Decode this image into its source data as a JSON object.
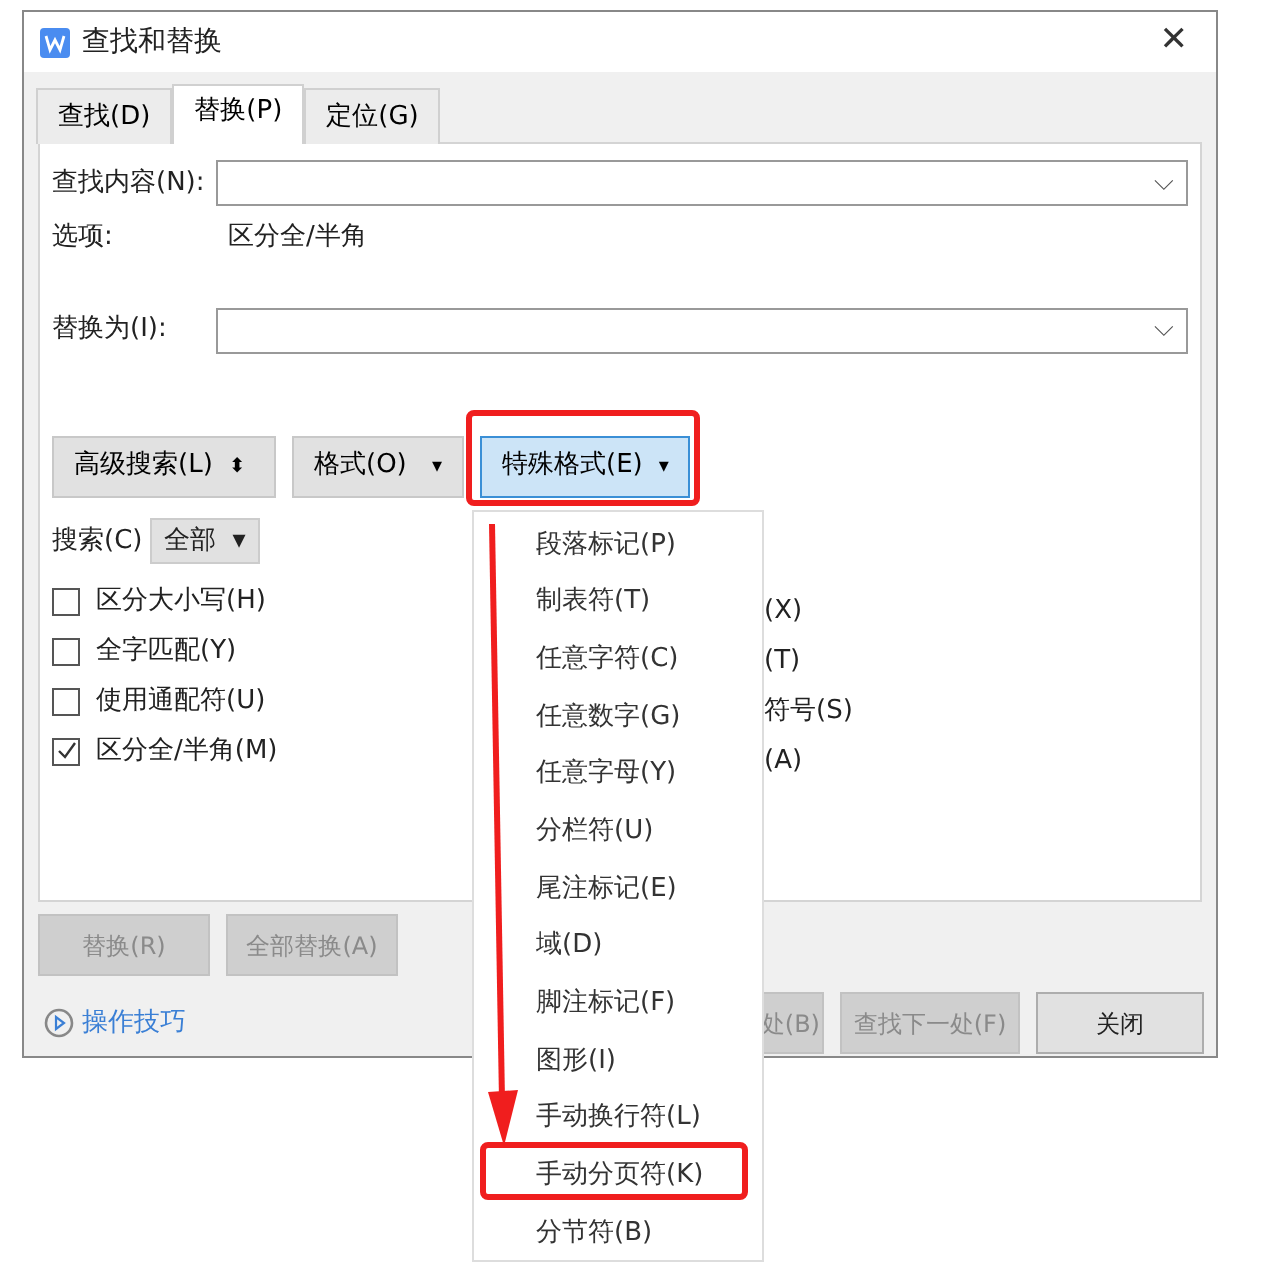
{
  "window": {
    "title": "查找和替换",
    "close": "✕"
  },
  "tabs": [
    {
      "label": "查找(D)",
      "selected": false
    },
    {
      "label": "替换(P)",
      "selected": true
    },
    {
      "label": "定位(G)",
      "selected": false
    }
  ],
  "find": {
    "label": "查找内容(N):",
    "caret": "⌵"
  },
  "options": {
    "label": "选项:",
    "value": "区分全/半角"
  },
  "replace": {
    "label": "替换为(I):",
    "caret": "⌵"
  },
  "tool_buttons": [
    {
      "label": "高级搜索(L)",
      "caret": "⬍",
      "active": false,
      "marked": false
    },
    {
      "label": "格式(O)",
      "caret": "▾",
      "active": false,
      "marked": false
    },
    {
      "label": "特殊格式(E)",
      "caret": "▾",
      "active": true,
      "marked": true
    }
  ],
  "search": {
    "label": "搜索(C)",
    "value": "全部",
    "caret": "▾"
  },
  "checkboxes": [
    {
      "label": "区分大小写(H)",
      "checked": false
    },
    {
      "label": "全字匹配(Y)",
      "checked": false
    },
    {
      "label": "使用通配符(U)",
      "checked": false
    },
    {
      "label": "区分全/半角(M)",
      "checked": true
    }
  ],
  "right_options": [
    "(X)",
    "(T)",
    "符号(S)",
    "(A)"
  ],
  "action_buttons": [
    {
      "label": "替换(R)",
      "disabled": true
    },
    {
      "label": "全部替换(A)",
      "disabled": true
    }
  ],
  "tips_link": "操作技巧",
  "footer_buttons": [
    {
      "label": "处(B)",
      "disabled": true
    },
    {
      "label": "查找下一处(F)",
      "disabled": true
    },
    {
      "label": "关闭",
      "disabled": false
    }
  ],
  "menu": [
    {
      "label": "段落标记(P)",
      "marked": false
    },
    {
      "label": "制表符(T)",
      "marked": false
    },
    {
      "label": "任意字符(C)",
      "marked": false
    },
    {
      "label": "任意数字(G)",
      "marked": false
    },
    {
      "label": "任意字母(Y)",
      "marked": false
    },
    {
      "label": "分栏符(U)",
      "marked": false
    },
    {
      "label": "尾注标记(E)",
      "marked": false
    },
    {
      "label": "域(D)",
      "marked": false
    },
    {
      "label": "脚注标记(F)",
      "marked": false
    },
    {
      "label": "图形(I)",
      "marked": false
    },
    {
      "label": "手动换行符(L)",
      "marked": false
    },
    {
      "label": "手动分页符(K)",
      "marked": true
    },
    {
      "label": "分节符(B)",
      "marked": false
    }
  ]
}
